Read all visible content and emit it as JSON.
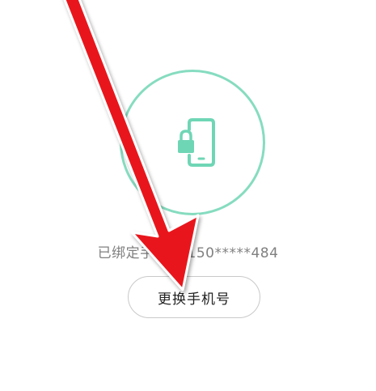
{
  "binding": {
    "status_text": "已绑定手机号 150*****484",
    "change_button_label": "更换手机号"
  },
  "icons": {
    "main_icon": "phone-lock-icon",
    "overlay": "red-arrow-annotation"
  },
  "colors": {
    "accent": "#6fd6b5",
    "circle_border": "#86dcc0",
    "arrow": "#e8141b"
  }
}
